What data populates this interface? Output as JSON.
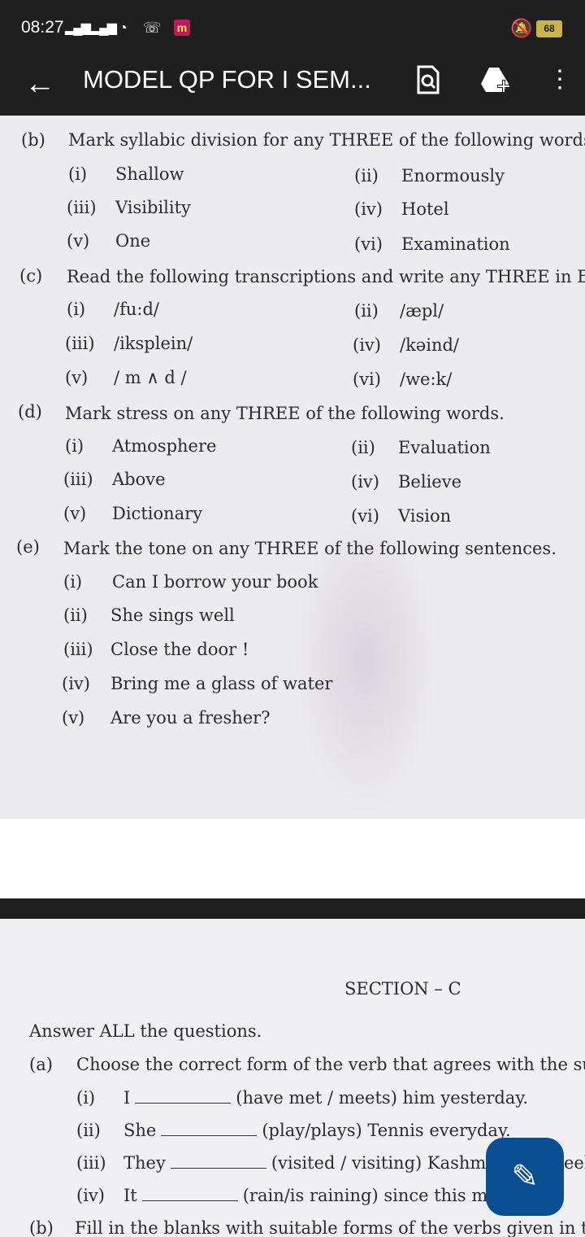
{
  "status": {
    "time": "08:27",
    "battery": "68"
  },
  "appbar": {
    "title": "MODEL QP FOR I SEM..."
  },
  "colors": {
    "bar": "#1f1f1f",
    "fab": "#0b4f93",
    "page": "#ecebee"
  },
  "icons": [
    "back-arrow-icon",
    "search-document-icon",
    "drive-add-icon",
    "more-vert-icon",
    "edit-icon"
  ],
  "q_b": {
    "label": "(b)",
    "text": "Mark syllabic division for any THREE of the following words:",
    "items": [
      [
        "(i)",
        "Shallow"
      ],
      [
        "(ii)",
        "Enormously"
      ],
      [
        "(iii)",
        "Visibility"
      ],
      [
        "(iv)",
        "Hotel"
      ],
      [
        "(v)",
        "One"
      ],
      [
        "(vi)",
        "Examination"
      ]
    ]
  },
  "q_c": {
    "label": "(c)",
    "text": "Read the following transcriptions and write any THREE in E",
    "items": [
      [
        "(i)",
        "/fu:d/"
      ],
      [
        "(ii)",
        "/æpl/"
      ],
      [
        "(iii)",
        "/iksplein/"
      ],
      [
        "(iv)",
        "/kǝind/"
      ],
      [
        "(v)",
        "/ m ∧ d /"
      ],
      [
        "(vi)",
        "/we:k/"
      ]
    ]
  },
  "q_d": {
    "label": "(d)",
    "text": "Mark stress on any THREE of the following words.",
    "items": [
      [
        "(i)",
        "Atmosphere"
      ],
      [
        "(ii)",
        "Evaluation"
      ],
      [
        "(iii)",
        "Above"
      ],
      [
        "(iv)",
        "Believe"
      ],
      [
        "(v)",
        "Dictionary"
      ],
      [
        "(vi)",
        "Vision"
      ]
    ]
  },
  "q_e": {
    "label": "(e)",
    "text": "Mark the tone on any THREE of the following sentences.",
    "items": [
      [
        "(i)",
        "Can I borrow your book"
      ],
      [
        "(ii)",
        "She sings well"
      ],
      [
        "(iii)",
        "Close the door !"
      ],
      [
        "(iv)",
        "Bring me a glass of water"
      ],
      [
        "(v)",
        "Are you a fresher?"
      ]
    ]
  },
  "section_c": {
    "heading": "SECTION – C",
    "instruction": "Answer ALL the questions.",
    "qa": {
      "label": "(a)",
      "text": "Choose the correct form of the verb that  agrees with the su",
      "items": [
        {
          "num": "(i)",
          "subj": "I",
          "rest": "(have met / meets) him yesterday."
        },
        {
          "num": "(ii)",
          "subj": "She",
          "rest": "(play/plays) Tennis everyday."
        },
        {
          "num": "(iii)",
          "subj": "They",
          "rest": "(visited / visiting) Kashm",
          "tail": "eek"
        },
        {
          "num": "(iv)",
          "subj": "It",
          "rest": "(rain/is raining) since this m"
        }
      ]
    },
    "qb": {
      "label": "(b)",
      "text": "Fill in the blanks with suitable forms of the verbs given in t"
    }
  }
}
